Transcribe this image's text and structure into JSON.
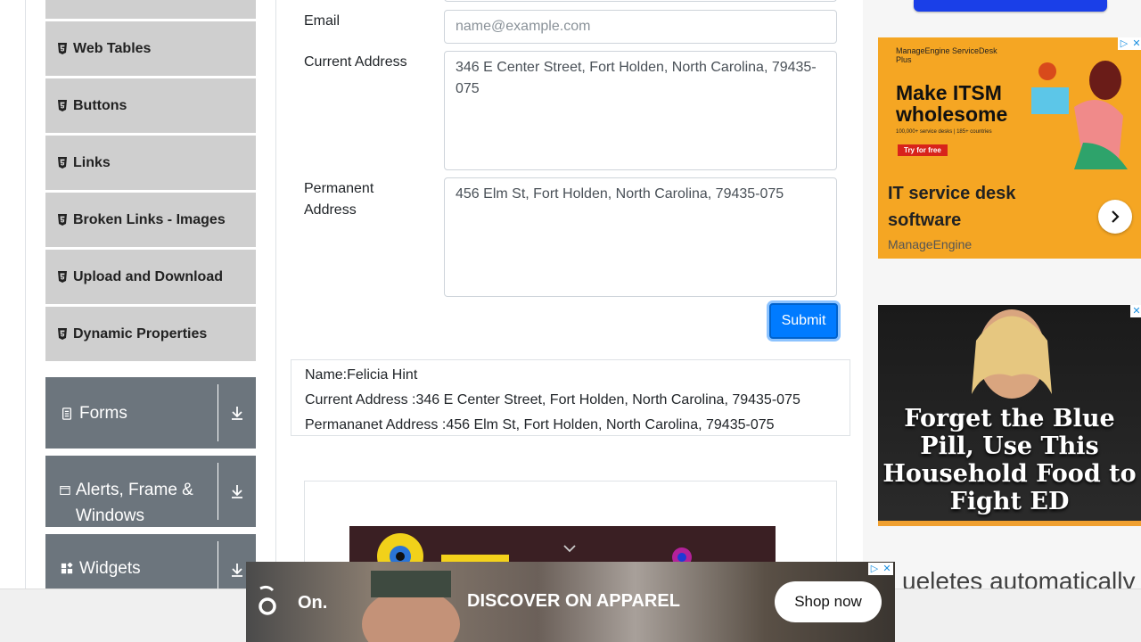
{
  "sidebar": {
    "items": [
      {
        "label": ""
      },
      {
        "label": "Web Tables"
      },
      {
        "label": "Buttons"
      },
      {
        "label": "Links"
      },
      {
        "label": "Broken Links - Images"
      },
      {
        "label": "Upload and Download"
      },
      {
        "label": "Dynamic Properties"
      }
    ],
    "groups": [
      {
        "label": "Forms",
        "icon": "form-icon"
      },
      {
        "label": "Alerts, Frame & Windows",
        "icon": "window-icon"
      },
      {
        "label": "Widgets",
        "icon": "widgets-icon"
      }
    ]
  },
  "form": {
    "email": {
      "label": "Email",
      "placeholder": "name@example.com",
      "value": ""
    },
    "current_address": {
      "label": "Current Address",
      "value": "346 E Center Street, Fort Holden, North Carolina, 79435-075"
    },
    "permanent_address": {
      "label": "Permanent Address",
      "value": "456 Elm St, Fort Holden, North Carolina, 79435-075"
    },
    "submit_label": "Submit"
  },
  "output": {
    "name": "Name:Felicia Hint",
    "current_address": "Current Address :346 E Center Street, Fort Holden, North Carolina, 79435-075",
    "permanent_address": "Permananet Address :456 Elm St, Fort Holden, North Carolina, 79435-075"
  },
  "ads": {
    "manageengine": {
      "brand": "ManageEngine ServiceDesk Plus",
      "headline_1": "Make ITSM",
      "headline_2": "wholesome",
      "sub": "100,000+ service desks | 185+ countries",
      "cta": "Try for free",
      "title": "IT service desk software",
      "advertiser": "ManageEngine"
    },
    "ed_ad": {
      "text": "Forget the Blue Pill, Use This Household Food to Fight ED"
    },
    "on_ad": {
      "logo_word": "On.",
      "tagline": "DISCOVER ON APPAREL",
      "cta": "Shop now"
    },
    "background_text": "ueletes automatically"
  },
  "colors": {
    "accent": "#007bff",
    "sidebar_item": "#cfcfcf",
    "group_bg": "#6c757d"
  }
}
